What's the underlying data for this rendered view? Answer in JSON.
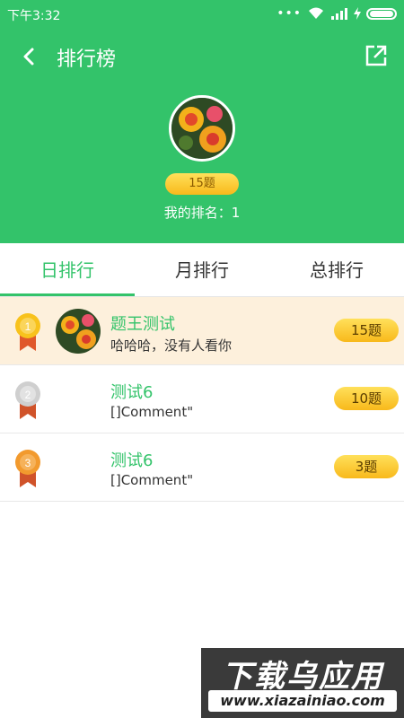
{
  "status_bar": {
    "time": "下午3:32",
    "dots": "•••"
  },
  "nav": {
    "title": "排行榜",
    "back_icon": "back-arrow-icon",
    "share_icon": "share-icon"
  },
  "profile": {
    "score": "15题",
    "rank_label": "我的排名：1"
  },
  "tabs": [
    {
      "label": "日排行",
      "active": true
    },
    {
      "label": "月排行",
      "active": false
    },
    {
      "label": "总排行",
      "active": false
    }
  ],
  "rows": [
    {
      "rank": "1",
      "name": "题王测试",
      "sub": "哈哈哈，没有人看你",
      "score": "15题",
      "has_avatar": true
    },
    {
      "rank": "2",
      "name": "测试6",
      "sub": "[]Comment\"",
      "score": "10题",
      "has_avatar": false
    },
    {
      "rank": "3",
      "name": "测试6",
      "sub": "[]Comment\"",
      "score": "3题",
      "has_avatar": false
    }
  ],
  "colors": {
    "accent": "#33c36a",
    "highlight_row": "#fdf0dc",
    "gold": "#f8b91b"
  },
  "watermark": {
    "top": "下载乌应用",
    "bottom": "www.xiazainiao.com"
  }
}
